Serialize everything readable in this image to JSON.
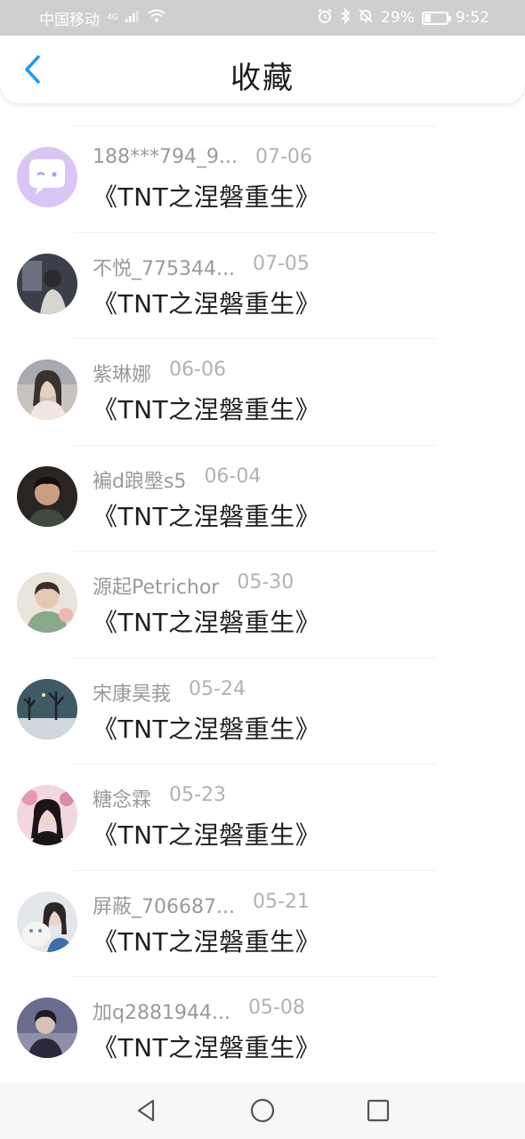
{
  "status_bar": {
    "carrier": "中国移动",
    "network": "4G",
    "battery": "29%",
    "battery_level": 0.29,
    "time": "9:52",
    "icons": [
      "signal-icon",
      "wifi-icon",
      "alarm-icon",
      "bluetooth-icon",
      "mute-icon",
      "battery-icon"
    ]
  },
  "header": {
    "title": "收藏",
    "back_icon": "chevron-left-icon",
    "accent_color": "#1e9bf0"
  },
  "favorites": [
    {
      "user": "188***794_9...",
      "date": "07-06",
      "book": "《TNT之涅磐重生》",
      "avatar": "chat-bubble-avatar"
    },
    {
      "user": "不悦_775344...",
      "date": "07-05",
      "book": "《TNT之涅磐重生》",
      "avatar": "photo-avatar"
    },
    {
      "user": "紫琳娜",
      "date": "06-06",
      "book": "《TNT之涅磐重生》",
      "avatar": "photo-avatar"
    },
    {
      "user": "褊d踉壂s5",
      "date": "06-04",
      "book": "《TNT之涅磐重生》",
      "avatar": "photo-avatar"
    },
    {
      "user": "源起Petrichor",
      "date": "05-30",
      "book": "《TNT之涅磐重生》",
      "avatar": "photo-avatar"
    },
    {
      "user": "宋康昊莪",
      "date": "05-24",
      "book": "《TNT之涅磐重生》",
      "avatar": "photo-avatar"
    },
    {
      "user": "糖念霖",
      "date": "05-23",
      "book": "《TNT之涅磐重生》",
      "avatar": "photo-avatar"
    },
    {
      "user": "屏蔽_706687...",
      "date": "05-21",
      "book": "《TNT之涅磐重生》",
      "avatar": "photo-avatar"
    },
    {
      "user": "加q2881944...",
      "date": "05-08",
      "book": "《TNT之涅磐重生》",
      "avatar": "photo-avatar"
    }
  ],
  "nav_bar": {
    "icons": [
      "nav-back-icon",
      "nav-home-icon",
      "nav-recents-icon"
    ]
  }
}
